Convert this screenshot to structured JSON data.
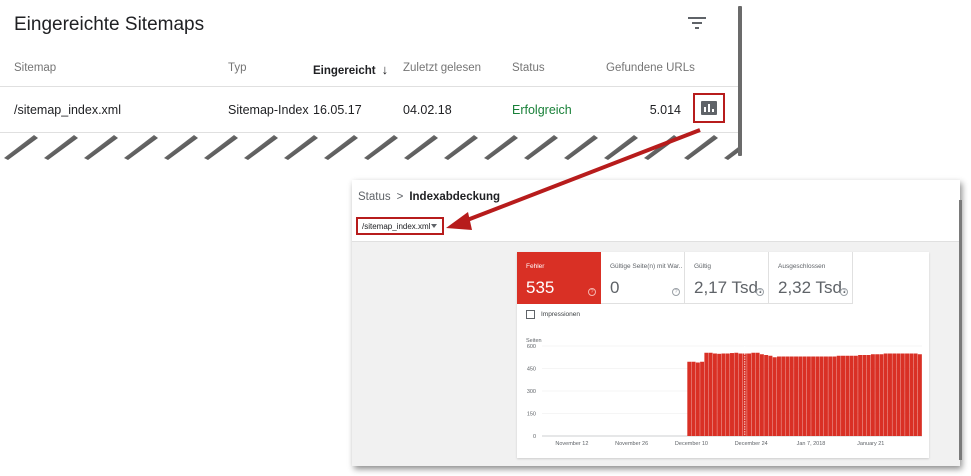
{
  "sitemaps": {
    "title": "Eingereichte Sitemaps",
    "columns": {
      "sitemap": "Sitemap",
      "type": "Typ",
      "submitted": "Eingereicht",
      "last_read": "Zuletzt gelesen",
      "status": "Status",
      "found_urls": "Gefundene URLs"
    },
    "rows": [
      {
        "sitemap": "/sitemap_index.xml",
        "type": "Sitemap-Index",
        "submitted": "16.05.17",
        "last_read": "04.02.18",
        "status": "Erfolgreich",
        "found_urls": "5.014"
      }
    ],
    "status_color": "#188038",
    "sort_arrow": "↓"
  },
  "coverage": {
    "breadcrumb": {
      "parent": "Status",
      "separator": ">",
      "current": "Indexabdeckung"
    },
    "sitemap_filter": "/sitemap_index.xml",
    "tiles": [
      {
        "label": "Fehler",
        "value": "535",
        "active": true
      },
      {
        "label": "Gültige Seite(n) mit War...",
        "value": "0",
        "active": false
      },
      {
        "label": "Gültig",
        "value": "2,17 Tsd.",
        "active": false
      },
      {
        "label": "Ausgeschlossen",
        "value": "2,32 Tsd.",
        "active": false
      }
    ],
    "impressions_label": "Impressionen",
    "accent_color": "#d93025"
  },
  "chart_data": {
    "type": "bar",
    "ylabel": "Seiten",
    "ylim": [
      0,
      600
    ],
    "yticks": [
      0,
      150,
      300,
      450,
      600
    ],
    "x_tick_labels": [
      "November 12",
      "November 26",
      "December 10",
      "December 24",
      "Jan 7, 2018",
      "January 21"
    ],
    "x_tick_positions": [
      7,
      21,
      35,
      49,
      63,
      77
    ],
    "series": [
      {
        "values": [
          0,
          0,
          0,
          0,
          0,
          0,
          0,
          0,
          0,
          0,
          0,
          0,
          0,
          0,
          0,
          0,
          0,
          0,
          0,
          0,
          0,
          0,
          0,
          0,
          0,
          0,
          0,
          0,
          0,
          0,
          0,
          0,
          0,
          0,
          495,
          495,
          490,
          495,
          555,
          555,
          550,
          548,
          550,
          550,
          553,
          555,
          550,
          550,
          550,
          555,
          555,
          545,
          540,
          535,
          525,
          530,
          530,
          530,
          530,
          530,
          530,
          530,
          530,
          530,
          530,
          530,
          530,
          530,
          530,
          535,
          535,
          535,
          535,
          535,
          540,
          540,
          540,
          545,
          545,
          545,
          550,
          550,
          550,
          550,
          550,
          550,
          550,
          550,
          545
        ]
      }
    ],
    "annotation_index": 47
  }
}
